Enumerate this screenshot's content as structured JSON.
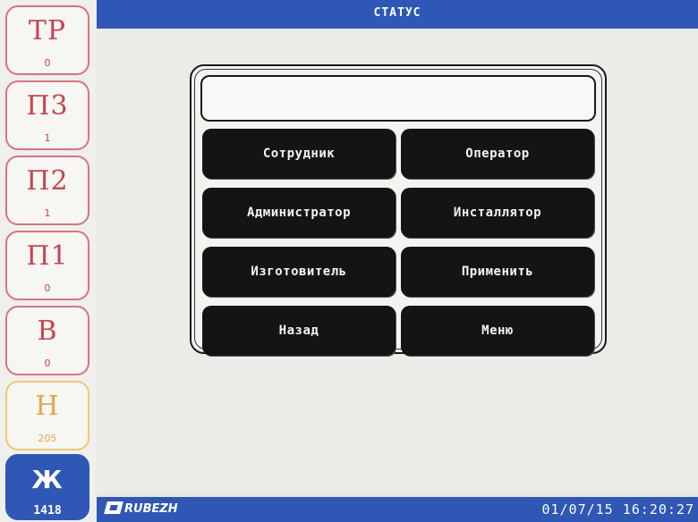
{
  "header": {
    "title": "СТАТУС"
  },
  "sidebar": {
    "items": [
      {
        "code": "ТР",
        "count": "0"
      },
      {
        "code": "П3",
        "count": "1"
      },
      {
        "code": "П2",
        "count": "1"
      },
      {
        "code": "П1",
        "count": "0"
      },
      {
        "code": "В",
        "count": "0"
      },
      {
        "code": "Н",
        "count": "205"
      },
      {
        "code": "Ж",
        "count": "1418"
      }
    ]
  },
  "main": {
    "display_value": "",
    "buttons": {
      "employee": "Сотрудник",
      "operator": "Оператор",
      "administrator": "Администратор",
      "installer": "Инсталлятор",
      "manufacturer": "Изготовитель",
      "apply": "Применить",
      "back": "Назад",
      "menu": "Меню"
    }
  },
  "footer": {
    "logo_text": "RUBEZH",
    "datetime": "01/07/15 16:20:27"
  },
  "colors": {
    "accent_blue": "#2e57b6",
    "alarm_red": "#c9434d",
    "warning_yellow": "#e8a646",
    "button_black": "#141414"
  }
}
